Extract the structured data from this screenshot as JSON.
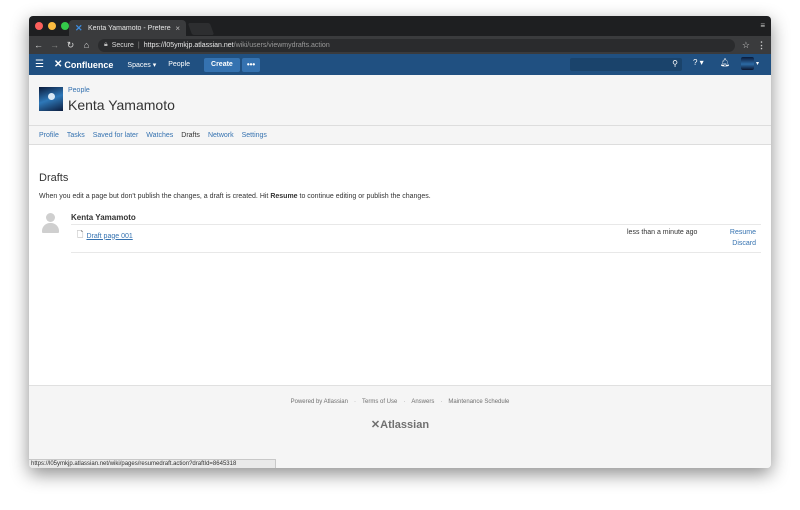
{
  "browser": {
    "tab_title": "Kenta Yamamoto - Preferences",
    "tab_close": "×",
    "url_secure_label": "Secure",
    "url_host": "https://l05ymkjp.atlassian.net",
    "url_path": "/wiki/users/viewmydrafts.action",
    "status_url": "https://l05ymkjp.atlassian.net/wiki/pages/resumedraft.action?draftId=8645318"
  },
  "colors": {
    "header_bg": "#205081",
    "create_button_bg": "#3572b0",
    "link": "#3572b0",
    "traffic_red": "#fc605c",
    "traffic_yellow": "#fdbc40",
    "traffic_green": "#34c84a"
  },
  "header": {
    "logo_text": "Confluence",
    "spaces_label": "Spaces ▾",
    "people_label": "People",
    "create_label": "Create",
    "more_label": "•••",
    "help_label": "? ▾",
    "avatar_caret": "▾"
  },
  "profile": {
    "breadcrumb": "People",
    "name": "Kenta Yamamoto"
  },
  "profile_nav": [
    {
      "label": "Profile"
    },
    {
      "label": "Tasks"
    },
    {
      "label": "Saved for later"
    },
    {
      "label": "Watches"
    },
    {
      "label": "Drafts"
    },
    {
      "label": "Network"
    },
    {
      "label": "Settings"
    }
  ],
  "drafts": {
    "title": "Drafts",
    "desc_before": "When you edit a page but don't publish the changes, a draft is created. Hit ",
    "desc_bold": "Resume",
    "desc_after": " to continue editing or publish the changes.",
    "group_user": "Kenta Yamamoto",
    "items": [
      {
        "title": "Draft page 001",
        "time": "less than a minute ago",
        "resume_label": "Resume",
        "discard_label": "Discard"
      }
    ]
  },
  "footer": {
    "links": [
      "Powered by Atlassian",
      "Terms of Use",
      "Answers",
      "Maintenance Schedule"
    ],
    "separator": "·",
    "logo_text": "Atlassian"
  }
}
